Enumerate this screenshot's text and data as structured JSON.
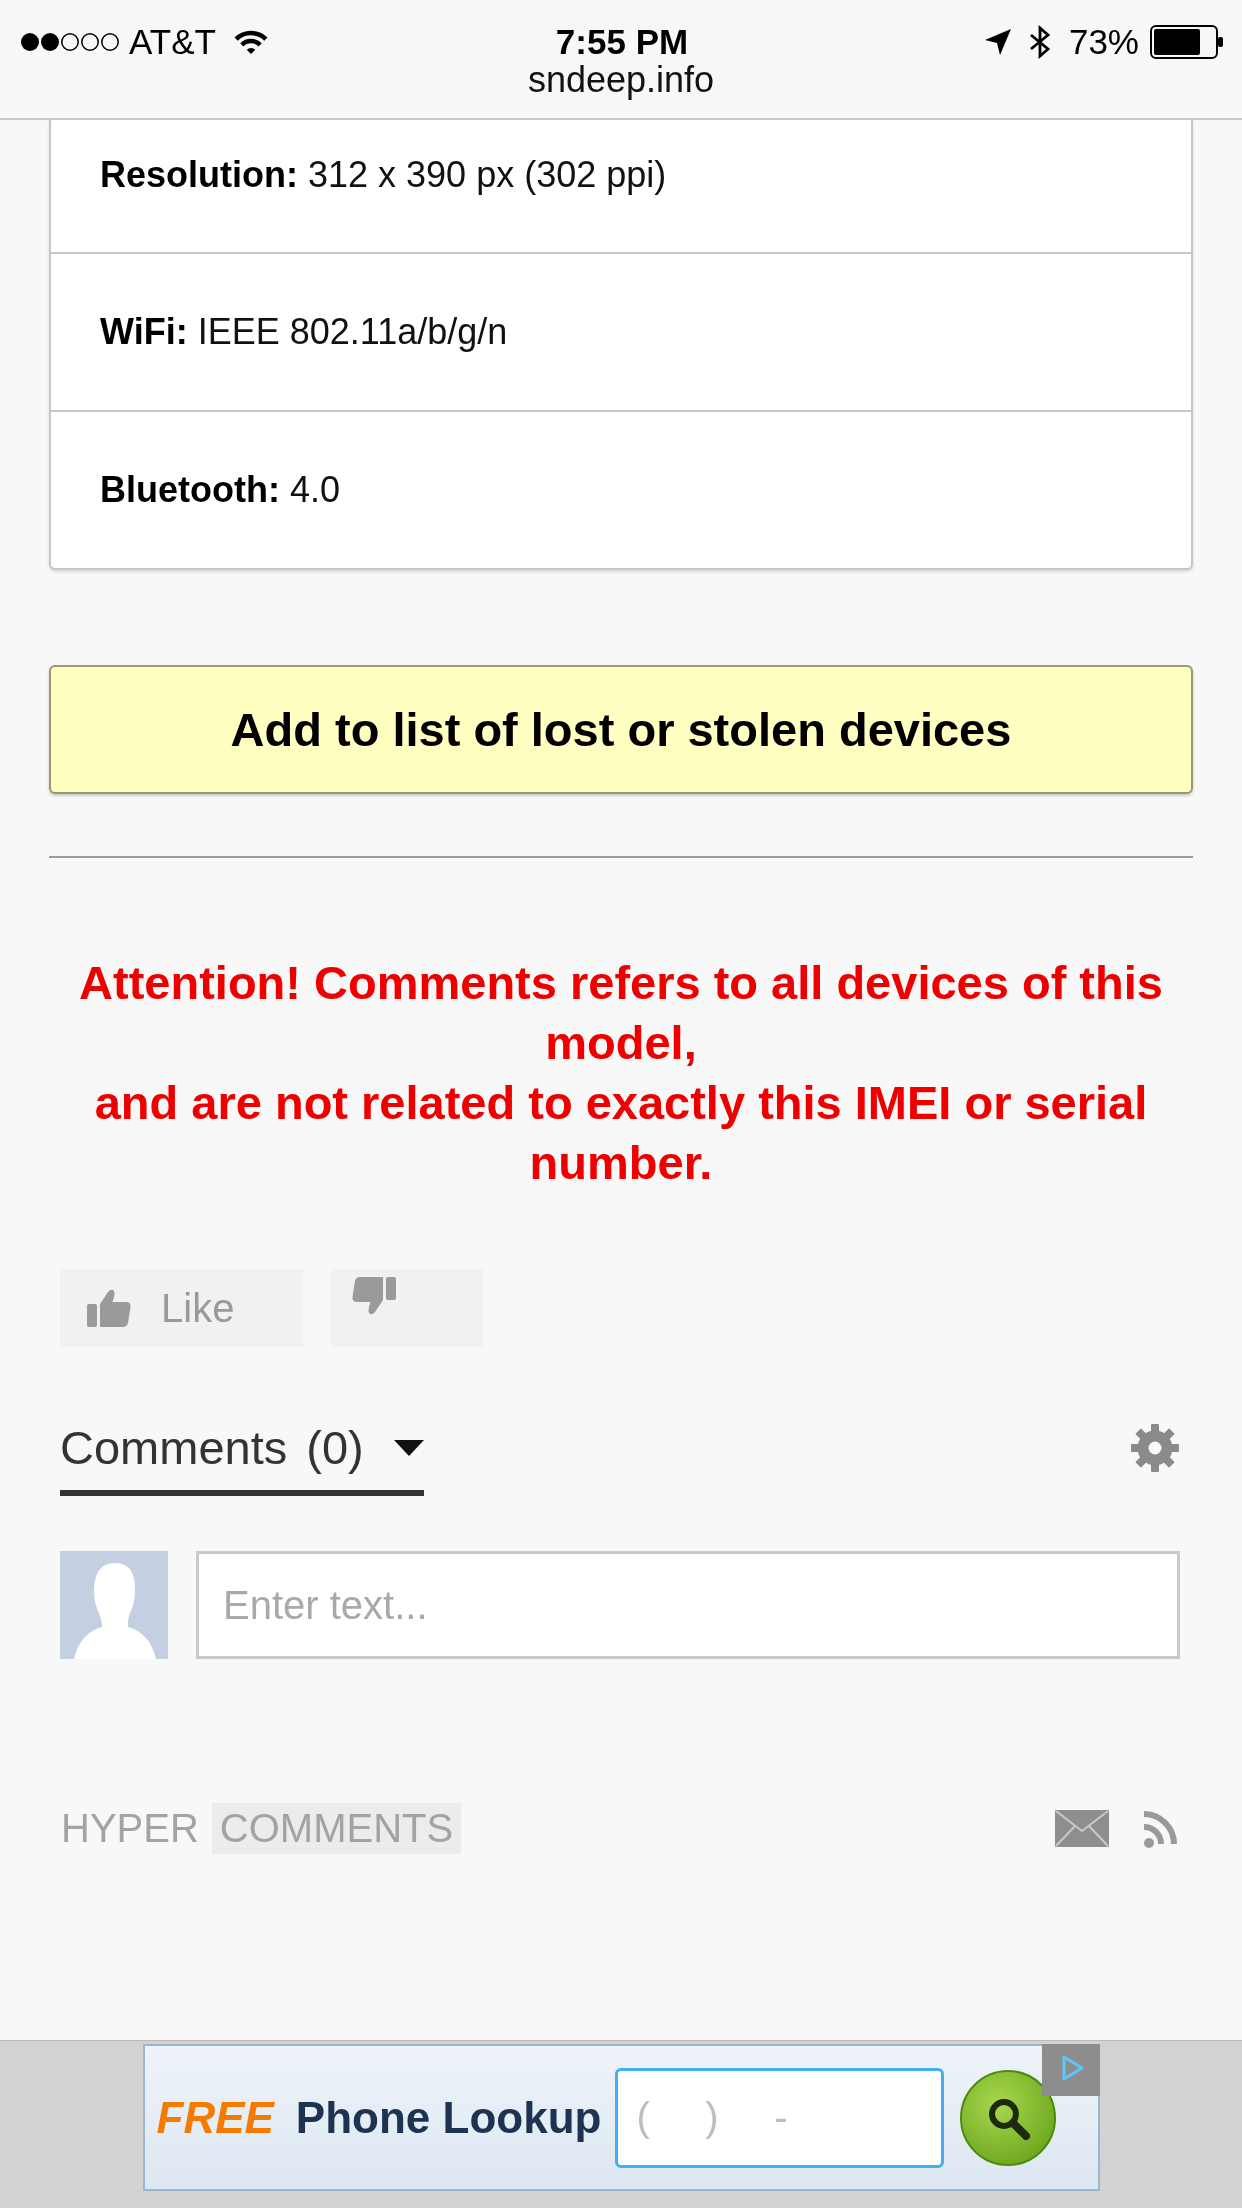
{
  "status_bar": {
    "carrier": "AT&T",
    "time": "7:55 PM",
    "battery": "73%",
    "url": "sndeep.info"
  },
  "specs": [
    {
      "label": "Resolution:",
      "value": "312 x 390 px (302 ppi)"
    },
    {
      "label": "WiFi:",
      "value": "IEEE 802.11a/b/g/n"
    },
    {
      "label": "Bluetooth:",
      "value": "4.0"
    }
  ],
  "report_button": {
    "label": "Add to list of lost or stolen devices"
  },
  "warning": {
    "lines": [
      "Attention! Comments refers to all devices of this model,",
      "and are not related to exactly this IMEI or serial number."
    ]
  },
  "votes": [
    {
      "kind": "like",
      "label": "Like"
    },
    {
      "kind": "dislike"
    }
  ],
  "comments": {
    "tabs": [
      {
        "label": "Comments",
        "count": "(0)",
        "selected": true
      }
    ],
    "input": {
      "placeholder": "Enter text..."
    }
  },
  "footer": {
    "logo": [
      {
        "text": "HYPER",
        "highlighted": false
      },
      {
        "text": "COMMENTS",
        "highlighted": true
      }
    ]
  },
  "ad": {
    "promo": "FREE",
    "title": "Phone Lookup",
    "phone_input": {
      "placeholder": "(     )     -"
    }
  }
}
